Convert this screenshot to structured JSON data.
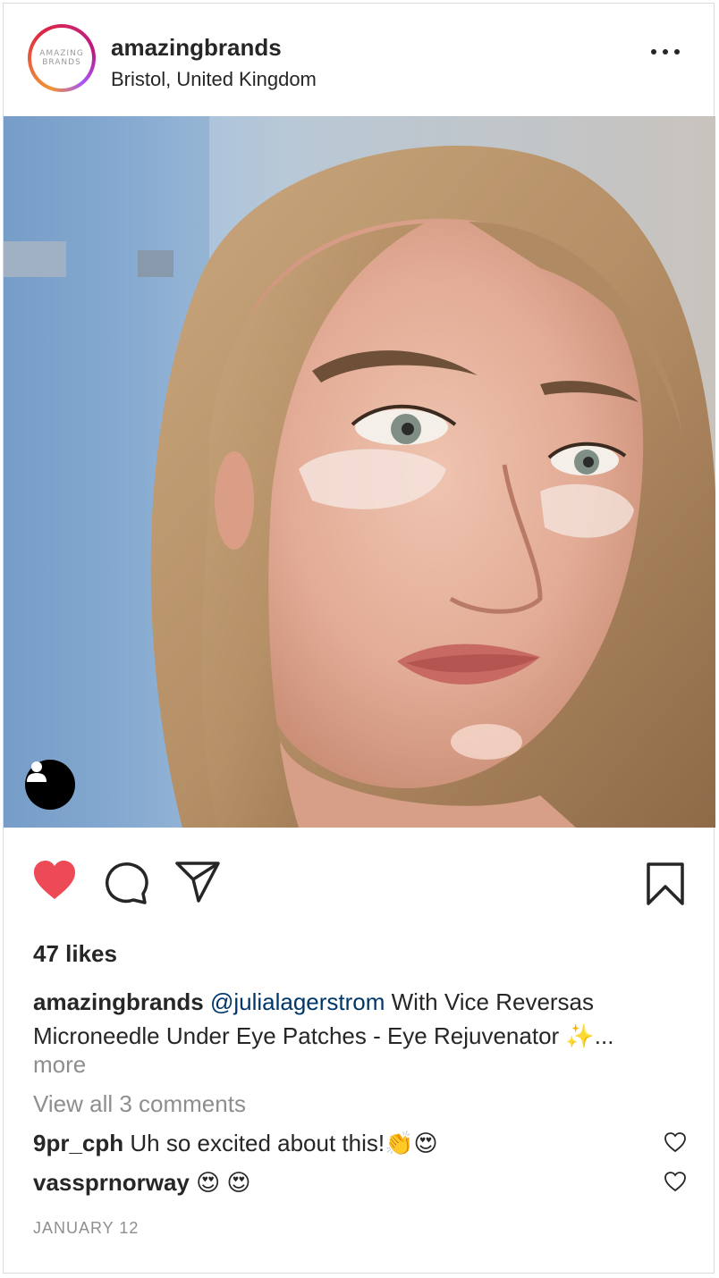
{
  "post": {
    "avatar_text": "AMAZING BRANDS",
    "username": "amazingbrands",
    "location": "Bristol, United Kingdom",
    "likes": "47 likes",
    "caption": {
      "username": "amazingbrands",
      "mention": "@julialagerstrom",
      "text": " With Vice Reversas Microneedle Under Eye Patches - Eye Rejuvenator ✨..."
    },
    "more_label": "more",
    "view_all_comments": "View all 3 comments",
    "comments": [
      {
        "username": "9pr_cph",
        "text": " Uh so excited about this!👏😍"
      },
      {
        "username": "vassprnorway",
        "text": " 😍 😍"
      }
    ],
    "date": "JANUARY 12"
  },
  "colors": {
    "like_red": "#ed4956",
    "mention_blue": "#00376b",
    "muted_gray": "#8e8e8e",
    "text": "#262626"
  },
  "icons": {
    "more": "more-dots-icon",
    "like": "heart-filled-icon",
    "comment": "comment-bubble-icon",
    "share": "paper-plane-icon",
    "save": "bookmark-icon",
    "user_tag": "user-tag-icon",
    "comment_like": "heart-outline-icon"
  }
}
